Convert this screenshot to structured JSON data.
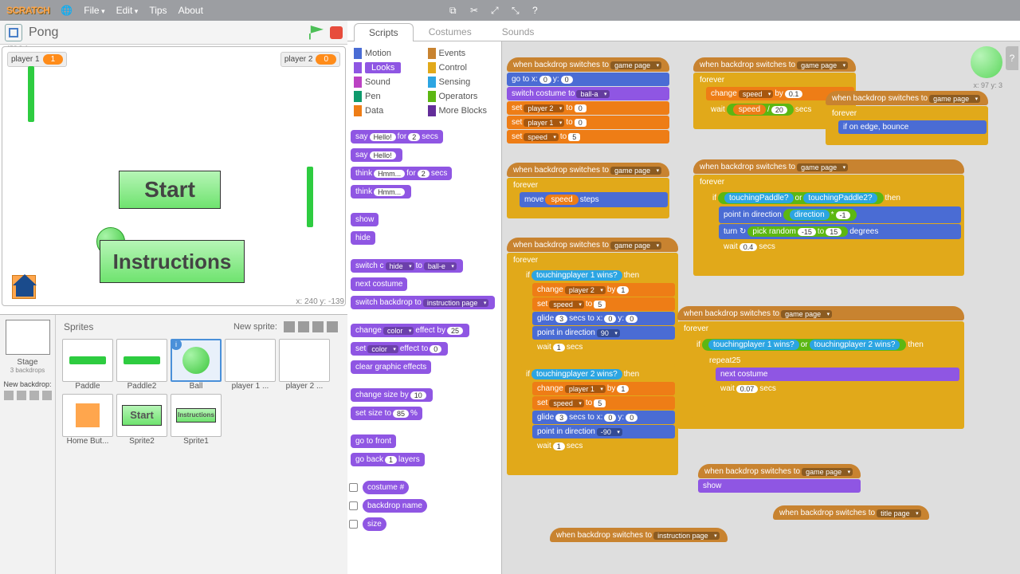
{
  "menubar": {
    "logo": "SCRATCH",
    "items": [
      "File",
      "Edit",
      "Tips",
      "About"
    ],
    "dropdowns": [
      true,
      true,
      false,
      false
    ]
  },
  "project": {
    "title": "Pong",
    "version": "v456.0.4",
    "mouse_xy": "x: 240   y: -139"
  },
  "vars": {
    "p1_label": "player 1",
    "p1_val": "1",
    "p2_label": "player 2",
    "p2_val": "0"
  },
  "stage_btns": {
    "start": "Start",
    "instructions": "Instructions"
  },
  "stagecol": {
    "title": "Stage",
    "sub": "3 backdrops",
    "newbackdrop": "New backdrop:"
  },
  "sprites": {
    "title": "Sprites",
    "new": "New sprite:",
    "list": [
      "Paddle",
      "Paddle2",
      "Ball",
      "player 1 ...",
      "player 2 ...",
      "Home But...",
      "Sprite2",
      "Sprite1"
    ],
    "selected": 2
  },
  "tabs": {
    "scripts": "Scripts",
    "costumes": "Costumes",
    "sounds": "Sounds"
  },
  "cats": {
    "motion": "Motion",
    "looks": "Looks",
    "sound": "Sound",
    "pen": "Pen",
    "data": "Data",
    "events": "Events",
    "control": "Control",
    "sensing": "Sensing",
    "operators": "Operators",
    "more": "More Blocks"
  },
  "palette_blocks": {
    "say_for": "say",
    "hello": "Hello!",
    "for": "for",
    "secs": "secs",
    "n2": "2",
    "say": "say",
    "think_for": "think",
    "hmm": "Hmm...",
    "think": "think",
    "show": "show",
    "hide": "hide",
    "switch_costume": "switch costume to",
    "hide_menu": "hide",
    "balle": "ball-e",
    "next_costume": "next costume",
    "switch_backdrop": "switch backdrop to",
    "instrpage": "instruction page",
    "change_effect": "change",
    "color": "color",
    "effect_by": "effect by",
    "n25": "25",
    "set_effect": "set",
    "effect_to": "effect to",
    "n0": "0",
    "clear_effects": "clear graphic effects",
    "change_size": "change size by",
    "n10": "10",
    "set_size": "set size to",
    "n85": "85",
    "pct": "%",
    "go_front": "go to front",
    "go_back": "go back",
    "n1": "1",
    "layers": "layers",
    "costume_num": "costume #",
    "backdrop_name": "backdrop name",
    "size": "size"
  },
  "script_text": {
    "when_backdrop": "when backdrop switches to",
    "gamepage": "game page",
    "titlepage": "title page",
    "instrpage": "instruction page",
    "go_to": "go to x:",
    "y": "y:",
    "n0": "0",
    "switch_costume": "switch costume to",
    "balla": "ball-a",
    "set": "set",
    "to": "to",
    "player2": "player 2",
    "player1": "player 1",
    "speed": "speed",
    "n5": "5",
    "forever": "forever",
    "move": "move",
    "steps": "steps",
    "if": "if",
    "then": "then",
    "or": "or",
    "touching": "touching",
    "p1wins": "player 1 wins",
    "p2wins": "player 2 wins",
    "paddle": "Paddle",
    "paddle2": "Paddle2",
    "q": "?",
    "change": "change",
    "by": "by",
    "n1": "1",
    "n01": "0.1",
    "glide": "glide",
    "n3": "3",
    "secs_to_x": "secs to x:",
    "point_dir": "point in direction",
    "d90": "90",
    "dm90": "-90",
    "direction": "direction",
    "star": "*",
    "nm1": "-1",
    "wait": "wait",
    "secs": "secs",
    "n007": "0.07",
    "n04": "0.4",
    "edge": "if on edge, bounce",
    "turn": "turn ↻",
    "pick_random": "pick random",
    "nm15": "-15",
    "n15": "15",
    "degrees": "degrees",
    "repeat": "repeat",
    "n25": "25",
    "next_costume": "next costume",
    "show": "show",
    "slash": "/",
    "n20": "20",
    "sprite_xy": "x: 97\ny: 3"
  }
}
